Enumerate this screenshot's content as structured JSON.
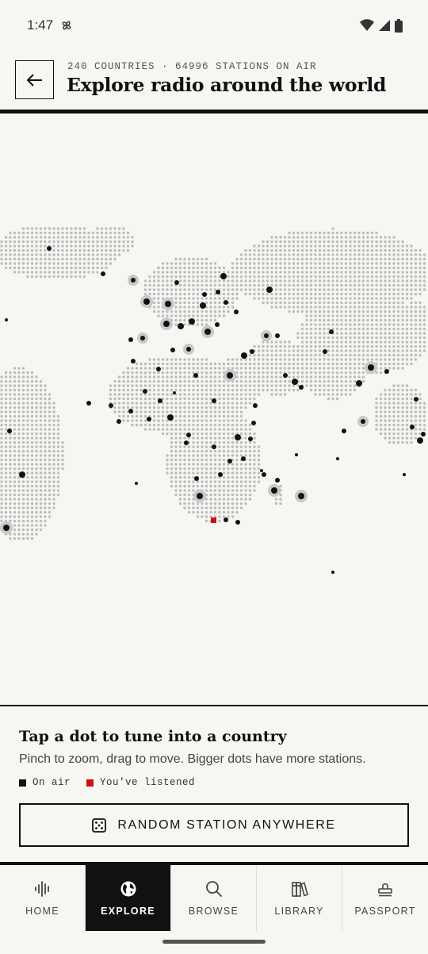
{
  "status_bar": {
    "time": "1:47"
  },
  "header": {
    "subtitle": "240 COUNTRIES · 64996 STATIONS ON AIR",
    "title": "Explore radio around the world"
  },
  "map": {
    "land_color": "#bdbdbd",
    "station_color": "#111111",
    "listened_color": "#cc1111"
  },
  "info": {
    "title": "Tap a dot to tune into a country",
    "subtitle": "Pinch to zoom, drag to move. Bigger dots have more stations.",
    "legend": [
      {
        "label": "On air",
        "color": "#111111"
      },
      {
        "label": "You've listened",
        "color": "#cc1111"
      }
    ],
    "random_button": "RANDOM STATION ANYWHERE"
  },
  "nav": [
    {
      "label": "HOME",
      "icon": "waveform-icon",
      "active": false
    },
    {
      "label": "EXPLORE",
      "icon": "globe-icon",
      "active": true
    },
    {
      "label": "BROWSE",
      "icon": "search-icon",
      "active": false
    },
    {
      "label": "LIBRARY",
      "icon": "books-icon",
      "active": false
    },
    {
      "label": "PASSPORT",
      "icon": "stamp-icon",
      "active": false
    }
  ]
}
